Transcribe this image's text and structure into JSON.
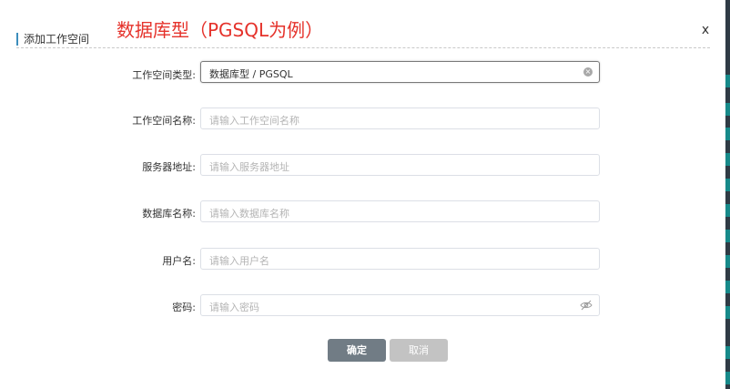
{
  "annotation": "数据库型（PGSQL为例）",
  "dialog": {
    "title": "添加工作空间",
    "close_label": "x"
  },
  "form": {
    "workspace_type": {
      "label": "工作空间类型:",
      "value": "数据库型 / PGSQL",
      "clear_icon": "clear-circle-icon"
    },
    "workspace_name": {
      "label": "工作空间名称:",
      "placeholder": "请输入工作空间名称"
    },
    "server_address": {
      "label": "服务器地址:",
      "placeholder": "请输入服务器地址"
    },
    "database_name": {
      "label": "数据库名称:",
      "placeholder": "请输入数据库名称"
    },
    "username": {
      "label": "用户名:",
      "placeholder": "请输入用户名"
    },
    "password": {
      "label": "密码:",
      "placeholder": "请输入密码",
      "toggle_icon": "eye-off-icon"
    }
  },
  "buttons": {
    "confirm": "确定",
    "cancel": "取消"
  },
  "colors": {
    "annotation": "#e5322b",
    "title_bar": "#3c8dbc",
    "confirm_bg": "#717c85",
    "cancel_bg": "#c3c3c3"
  }
}
